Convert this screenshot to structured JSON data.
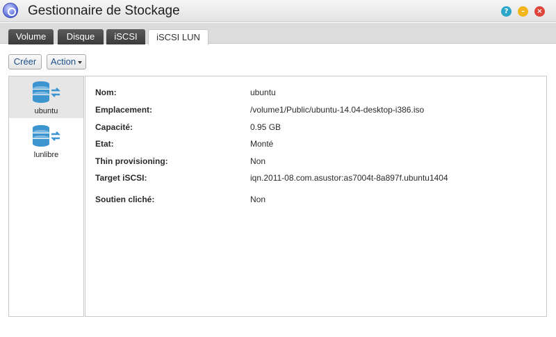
{
  "window": {
    "title": "Gestionnaire de Stockage",
    "controls": {
      "help": "?",
      "minimize": "–",
      "close": "×"
    }
  },
  "tabs": [
    {
      "label": "Volume",
      "active": false
    },
    {
      "label": "Disque",
      "active": false
    },
    {
      "label": "iSCSI",
      "active": false
    },
    {
      "label": "iSCSI LUN",
      "active": true
    }
  ],
  "toolbar": {
    "create_label": "Créer",
    "action_label": "Action"
  },
  "lun_list": [
    {
      "name": "ubuntu",
      "selected": true,
      "icon": "database-share-icon"
    },
    {
      "name": "lunlibre",
      "selected": false,
      "icon": "database-share-icon"
    }
  ],
  "details": [
    {
      "label": "Nom:",
      "value": "ubuntu"
    },
    {
      "label": "Emplacement:",
      "value": "/volume1/Public/ubuntu-14.04-desktop-i386.iso"
    },
    {
      "label": "Capacité:",
      "value": "0.95 GB"
    },
    {
      "label": "Etat:",
      "value": "Monté"
    },
    {
      "label": "Thin provisioning:",
      "value": "Non"
    },
    {
      "label": "Target iSCSI:",
      "value": "iqn.2011-08.com.asustor:as7004t-8a897f.ubuntu1404"
    },
    {
      "label": "Soutien cliché:",
      "value": "Non"
    }
  ],
  "colors": {
    "accent_blue": "#3d95d0",
    "help": "#2aa6c9",
    "minimize": "#f2b51c",
    "close": "#e0453a"
  }
}
